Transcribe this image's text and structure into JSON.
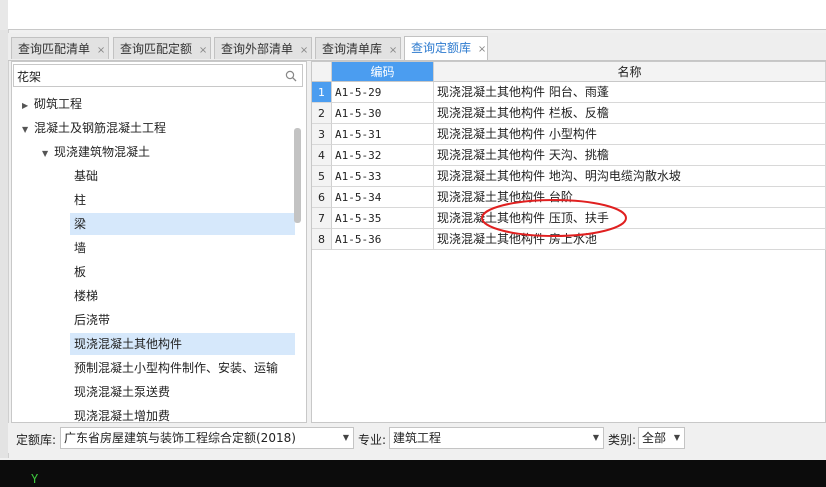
{
  "tabs": [
    {
      "label": "查询匹配清单",
      "active": false
    },
    {
      "label": "查询匹配定额",
      "active": false
    },
    {
      "label": "查询外部清单",
      "active": false
    },
    {
      "label": "查询清单库",
      "active": false
    },
    {
      "label": "查询定额库",
      "active": true
    }
  ],
  "tab_close": "×",
  "search": {
    "value": "花架",
    "icon": "search-icon"
  },
  "tree": [
    {
      "label": "砌筑工程",
      "level": 0,
      "arrow": "▶",
      "selected": false
    },
    {
      "label": "混凝土及钢筋混凝土工程",
      "level": 0,
      "arrow": "▼",
      "selected": false
    },
    {
      "label": "现浇建筑物混凝土",
      "level": 1,
      "arrow": "▼",
      "selected": false
    },
    {
      "label": "基础",
      "level": 2,
      "arrow": "",
      "selected": false
    },
    {
      "label": "柱",
      "level": 2,
      "arrow": "",
      "selected": false
    },
    {
      "label": "梁",
      "level": 2,
      "arrow": "",
      "selected": true
    },
    {
      "label": "墙",
      "level": 2,
      "arrow": "",
      "selected": false
    },
    {
      "label": "板",
      "level": 2,
      "arrow": "",
      "selected": false
    },
    {
      "label": "楼梯",
      "level": 2,
      "arrow": "",
      "selected": false
    },
    {
      "label": "后浇带",
      "level": 2,
      "arrow": "",
      "selected": false
    },
    {
      "label": "现浇混凝土其他构件",
      "level": 2,
      "arrow": "",
      "selected": true
    },
    {
      "label": "预制混凝土小型构件制作、安装、运输",
      "level": 2,
      "arrow": "",
      "selected": false
    },
    {
      "label": "现浇混凝土泵送费",
      "level": 2,
      "arrow": "",
      "selected": false
    },
    {
      "label": "现浇混凝土增加费",
      "level": 2,
      "arrow": "",
      "selected": false
    }
  ],
  "grid": {
    "headers": {
      "code": "编码",
      "name": "名称"
    },
    "rows": [
      {
        "num": "1",
        "code": "A1-5-29",
        "name": "现浇混凝土其他构件 阳台、雨蓬"
      },
      {
        "num": "2",
        "code": "A1-5-30",
        "name": "现浇混凝土其他构件 栏板、反檐"
      },
      {
        "num": "3",
        "code": "A1-5-31",
        "name": "现浇混凝土其他构件 小型构件"
      },
      {
        "num": "4",
        "code": "A1-5-32",
        "name": "现浇混凝土其他构件 天沟、挑檐"
      },
      {
        "num": "5",
        "code": "A1-5-33",
        "name": "现浇混凝土其他构件 地沟、明沟电缆沟散水坡"
      },
      {
        "num": "6",
        "code": "A1-5-34",
        "name": "现浇混凝土其他构件 台阶"
      },
      {
        "num": "7",
        "code": "A1-5-35",
        "name": "现浇混凝土其他构件 压顶、扶手"
      },
      {
        "num": "8",
        "code": "A1-5-36",
        "name": "现浇混凝土其他构件 房上水池"
      }
    ],
    "current_row": "1"
  },
  "footer": {
    "quota_label": "定额库:",
    "quota_value": "广东省房屋建筑与装饰工程综合定额(2018)",
    "major_label": "专业:",
    "major_value": "建筑工程",
    "category_label": "类别:",
    "category_value": "全部"
  },
  "taskbar": {
    "text": "Y"
  },
  "colors": {
    "accent": "#4b9df0",
    "annotation": "#e02020",
    "selection": "#d6e8fb"
  }
}
